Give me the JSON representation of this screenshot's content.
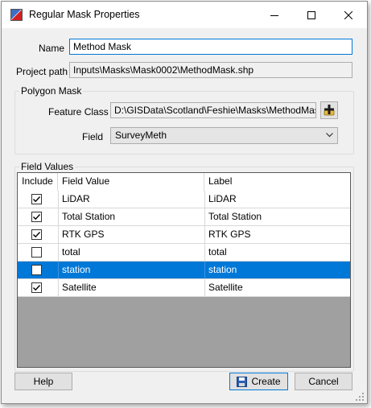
{
  "window": {
    "title": "Regular Mask Properties"
  },
  "form": {
    "name_label": "Name",
    "name_value": "Method Mask",
    "project_path_label": "Project path",
    "project_path_value": "Inputs\\Masks\\Mask0002\\MethodMask.shp"
  },
  "polygon_mask": {
    "group_title": "Polygon Mask",
    "feature_class_label": "Feature Class",
    "feature_class_value": "D:\\GISData\\Scotland\\Feshie\\Masks\\MethodMask.s",
    "field_label": "Field",
    "field_value": "SurveyMeth"
  },
  "field_values": {
    "group_title": "Field Values",
    "columns": [
      "Include",
      "Field Value",
      "Label"
    ],
    "rows": [
      {
        "include": true,
        "field_value": "LiDAR",
        "label": "LiDAR",
        "selected": false
      },
      {
        "include": true,
        "field_value": "Total Station",
        "label": "Total Station",
        "selected": false
      },
      {
        "include": true,
        "field_value": "RTK GPS",
        "label": "RTK GPS",
        "selected": false
      },
      {
        "include": false,
        "field_value": "total",
        "label": "total",
        "selected": false
      },
      {
        "include": false,
        "field_value": "station",
        "label": "station",
        "selected": true
      },
      {
        "include": true,
        "field_value": "Satellite",
        "label": "Satellite",
        "selected": false
      }
    ]
  },
  "buttons": {
    "help": "Help",
    "create": "Create",
    "cancel": "Cancel"
  },
  "colors": {
    "selection": "#0078d7",
    "grid_empty": "#a0a0a0",
    "dialog_bg": "#f0f0f0"
  }
}
